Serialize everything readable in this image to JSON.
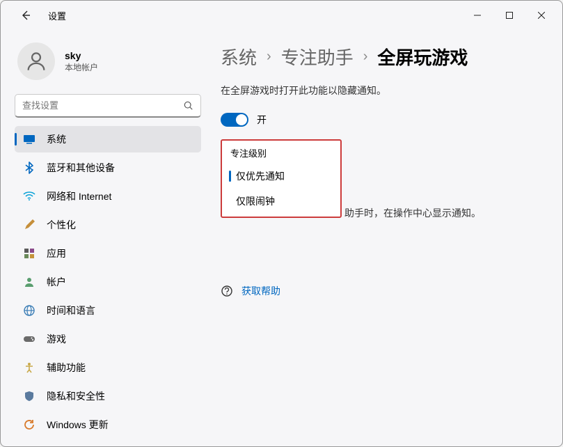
{
  "titlebar": {
    "title": "设置"
  },
  "user": {
    "name": "sky",
    "subtitle": "本地帐户"
  },
  "search": {
    "placeholder": "查找设置"
  },
  "nav": {
    "items": [
      {
        "label": "系统",
        "iconColor": "#0067c0"
      },
      {
        "label": "蓝牙和其他设备",
        "iconColor": "#0067c0"
      },
      {
        "label": "网络和 Internet",
        "iconColor": "#0aa2d8"
      },
      {
        "label": "个性化",
        "iconColor": "#c58f3a"
      },
      {
        "label": "应用",
        "iconColor": "#5a5a5a"
      },
      {
        "label": "帐户",
        "iconColor": "#5a9e6f"
      },
      {
        "label": "时间和语言",
        "iconColor": "#3a7db5"
      },
      {
        "label": "游戏",
        "iconColor": "#6a6a6a"
      },
      {
        "label": "辅助功能",
        "iconColor": "#c9a94a"
      },
      {
        "label": "隐私和安全性",
        "iconColor": "#5a7a9e"
      },
      {
        "label": "Windows 更新",
        "iconColor": "#d87a2a"
      }
    ]
  },
  "breadcrumb": {
    "crumb1": "系统",
    "crumb2": "专注助手",
    "current": "全屏玩游戏"
  },
  "description": "在全屏游戏时打开此功能以隐藏通知。",
  "toggle": {
    "state": "开"
  },
  "dropdown": {
    "title": "专注级别",
    "option1": "仅优先通知",
    "option2": "仅限闹钟"
  },
  "hint": "助手时，在操作中心显示通知。",
  "help": {
    "label": "获取帮助"
  }
}
